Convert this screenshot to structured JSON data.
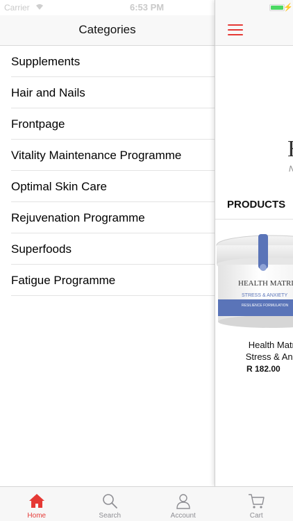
{
  "status_bar": {
    "carrier": "Carrier",
    "time": "6:53 PM",
    "battery_level": 1.0
  },
  "drawer": {
    "title": "Categories",
    "items": [
      {
        "label": "Supplements"
      },
      {
        "label": "Hair and Nails"
      },
      {
        "label": "Frontpage"
      },
      {
        "label": "Vitality Maintenance Programme"
      },
      {
        "label": "Optimal Skin Care"
      },
      {
        "label": "Rejuvenation Programme"
      },
      {
        "label": "Superfoods"
      },
      {
        "label": "Fatigue Programme"
      }
    ]
  },
  "content": {
    "menu_icon": "hamburger-menu-icon",
    "logo_text": "H",
    "logo_subtext": "N",
    "products_heading": "PRODUCTS",
    "product": {
      "name_line1": "Health Matrix",
      "name_line2": "Stress & Anxie",
      "price": "R 182.00",
      "jar_label_brand": "HEALTH MATRIX",
      "jar_label_product": "STRESS & ANXIETY",
      "jar_label_formula": "RESILIENCE FORMULATION"
    }
  },
  "tab_bar": {
    "tabs": [
      {
        "label": "Home",
        "icon": "home-icon",
        "active": true
      },
      {
        "label": "Search",
        "icon": "search-icon",
        "active": false
      },
      {
        "label": "Account",
        "icon": "account-icon",
        "active": false
      },
      {
        "label": "Cart",
        "icon": "cart-icon",
        "active": false
      }
    ]
  },
  "colors": {
    "accent": "#e53935",
    "inactive_tab": "#8e8e93",
    "jar_blue": "#5a74b8"
  }
}
